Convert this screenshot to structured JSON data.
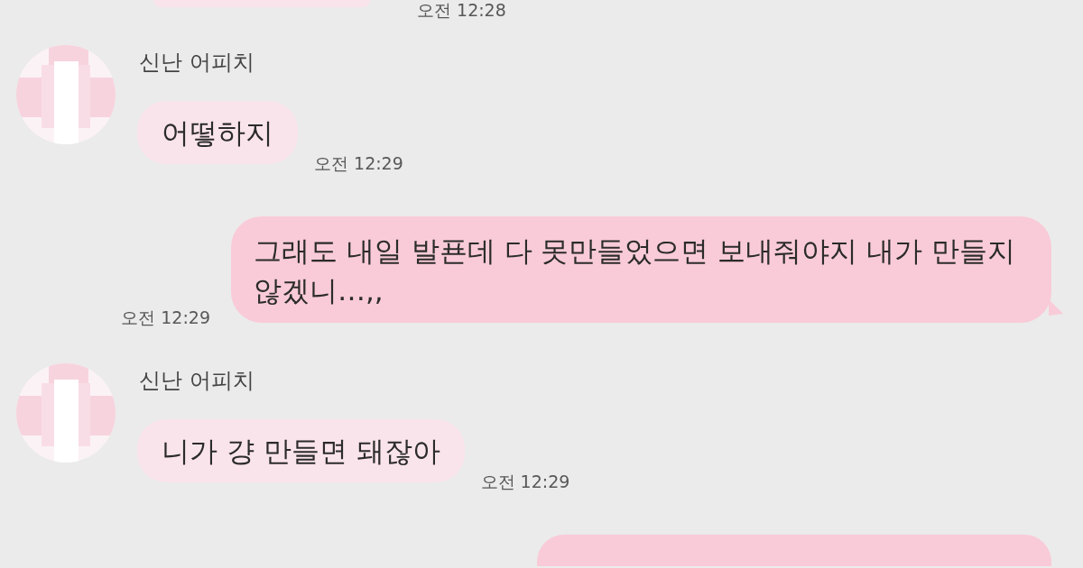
{
  "chat": {
    "messages": [
      {
        "kind": "incoming",
        "cut_off": true,
        "time": "오전 12:28"
      },
      {
        "kind": "incoming",
        "sender": "신난 어피치",
        "text": "어떻하지",
        "time": "오전 12:29"
      },
      {
        "kind": "outgoing",
        "text": "그래도 내일 발푠데 다 못만들었으면 보내줘야지 내가 만들지\n않겠니…,,",
        "time": "오전 12:29"
      },
      {
        "kind": "incoming",
        "sender": "신난 어피치",
        "text": "니가 걍 만들면 돼잖아",
        "time": "오전 12:29"
      },
      {
        "kind": "outgoing",
        "cut_off": true
      }
    ]
  }
}
